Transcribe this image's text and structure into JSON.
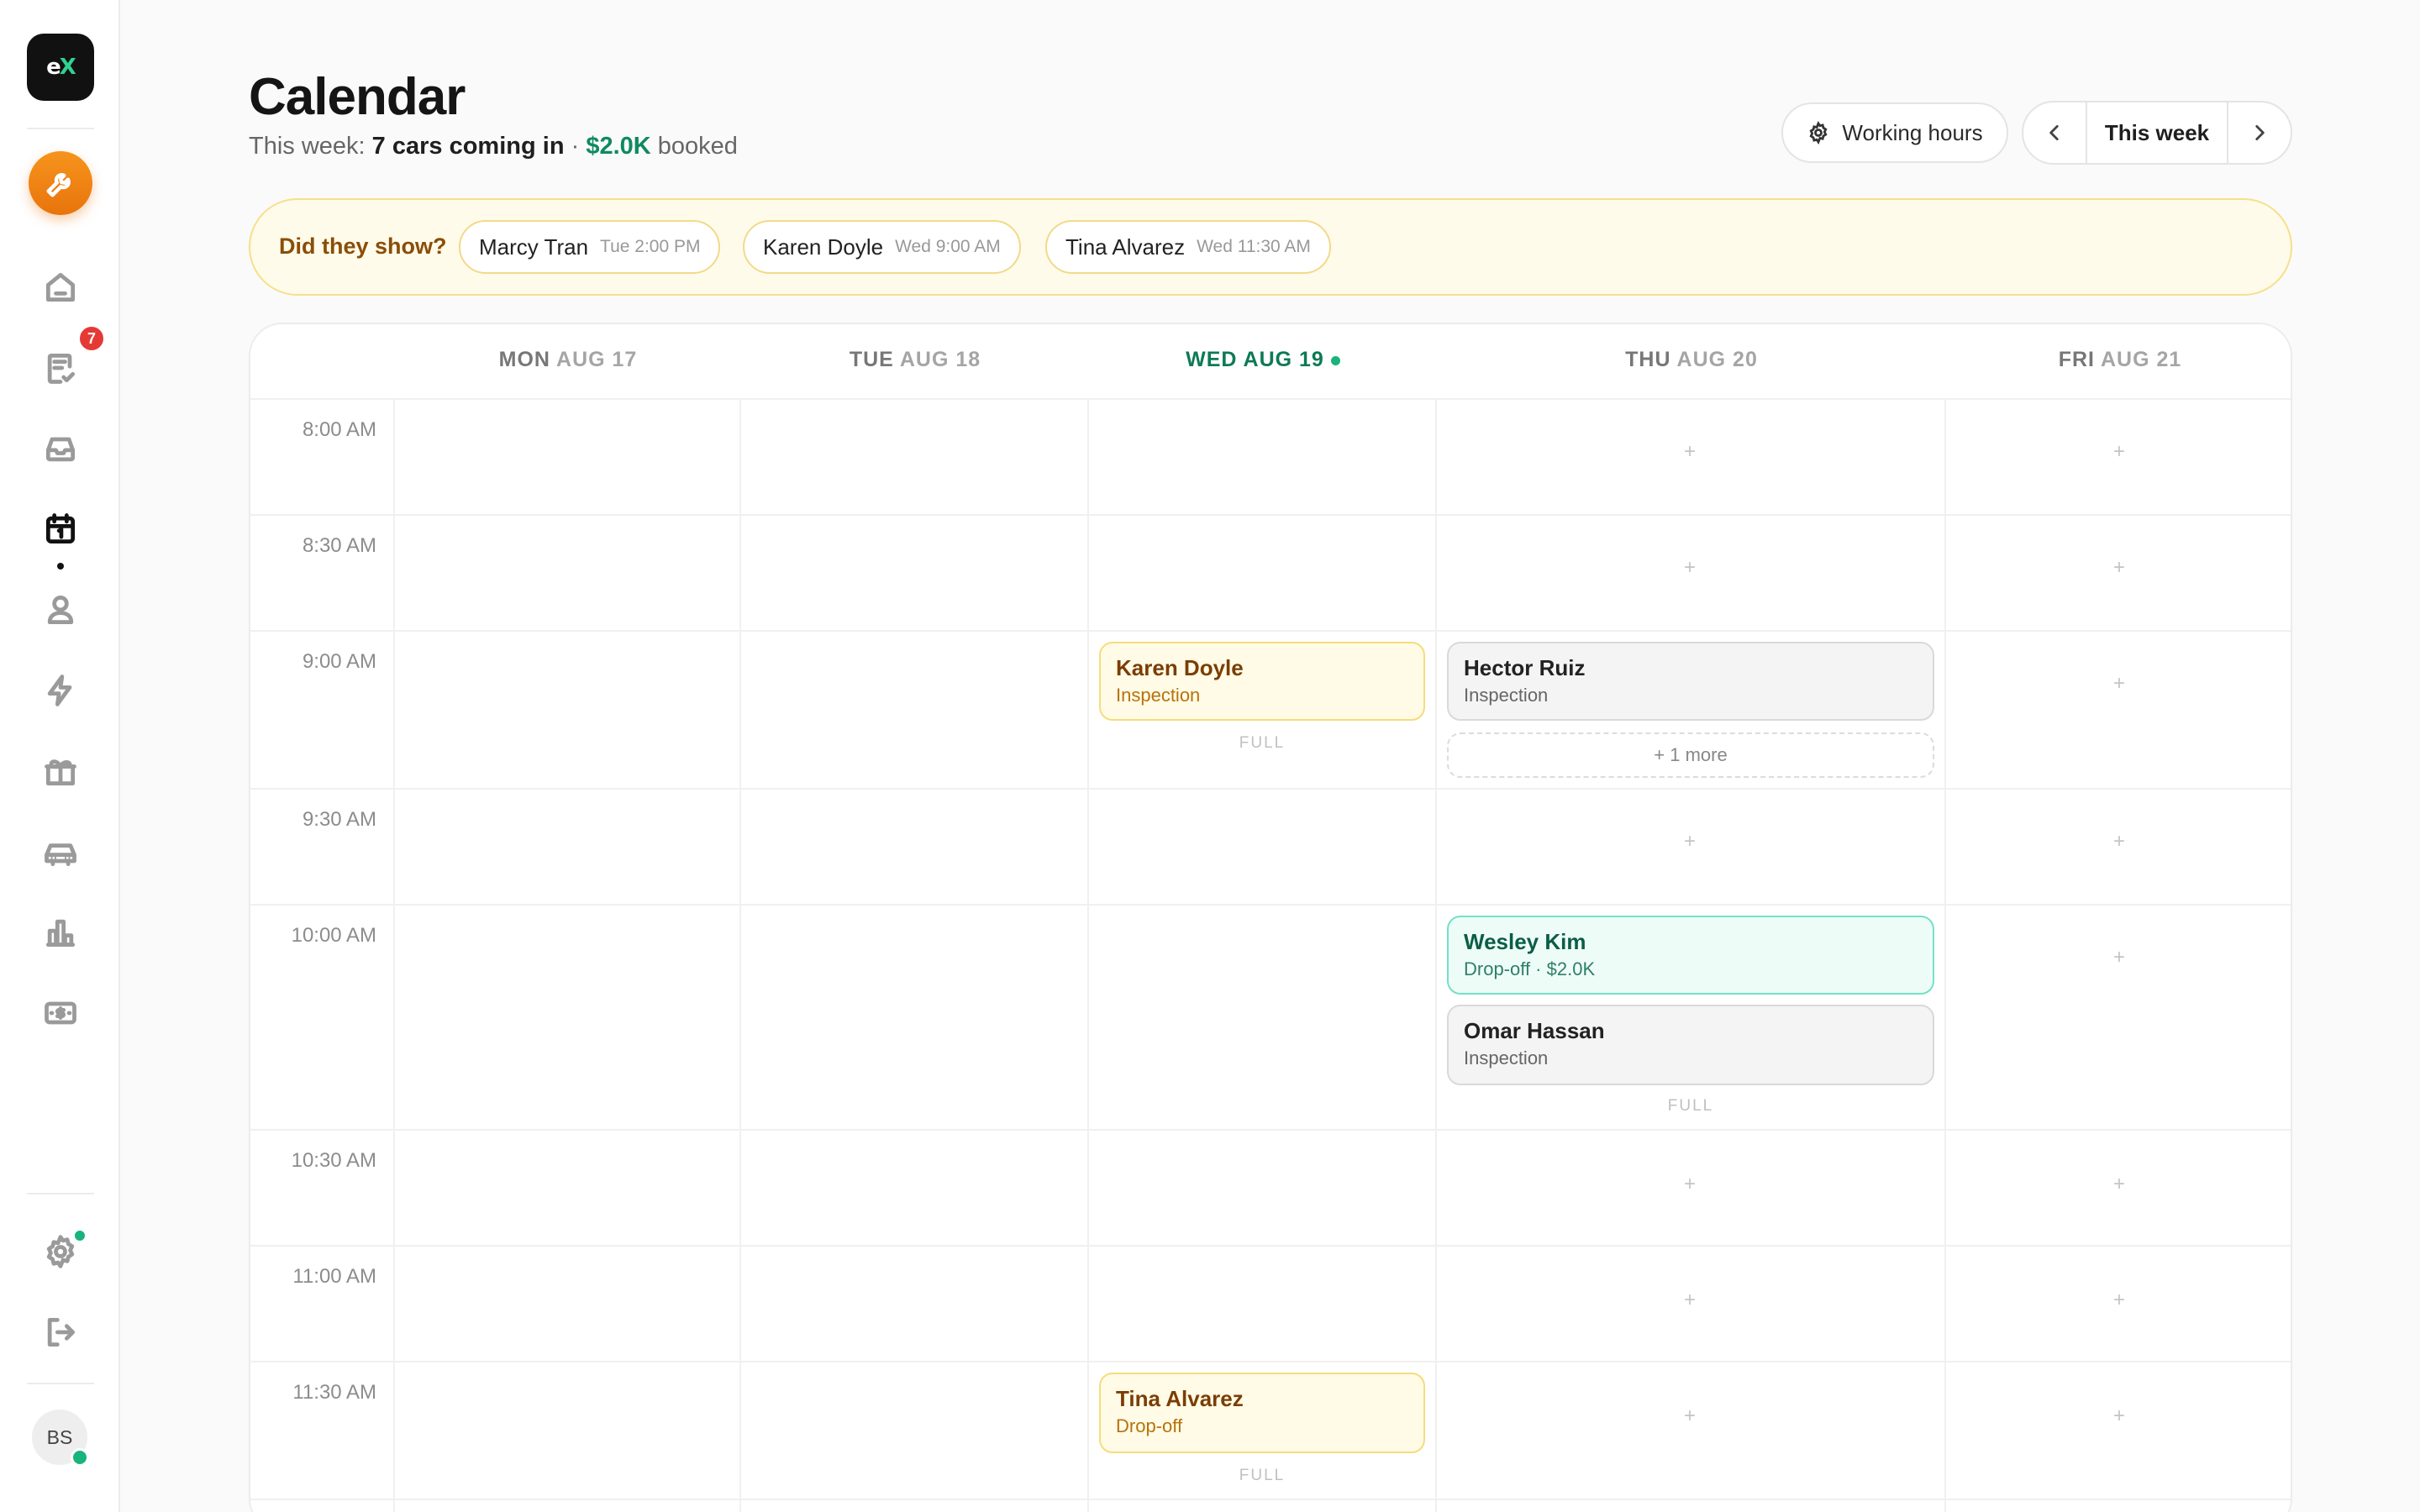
{
  "sidebar": {
    "logo": {
      "e": "e",
      "x": "X"
    },
    "nav_badge_count": "7",
    "avatar_initials": "BS"
  },
  "header": {
    "title": "Calendar",
    "subtitle_prefix": "This week: ",
    "subtitle_cars": "7 cars coming in",
    "subtitle_sep": " · ",
    "subtitle_money": "$2.0K",
    "subtitle_suffix": " booked",
    "working_hours_label": "Working hours",
    "week_label": "This week"
  },
  "banner": {
    "label": "Did they show?",
    "chips": [
      {
        "name": "Marcy Tran",
        "time": "Tue 2:00 PM"
      },
      {
        "name": "Karen Doyle",
        "time": "Wed 9:00 AM"
      },
      {
        "name": "Tina Alvarez",
        "time": "Wed 11:30 AM"
      }
    ]
  },
  "calendar": {
    "days": [
      {
        "name": "MON",
        "date": "AUG 17"
      },
      {
        "name": "TUE",
        "date": "AUG 18"
      },
      {
        "name": "WED",
        "date": "AUG 19"
      },
      {
        "name": "THU",
        "date": "AUG 20"
      },
      {
        "name": "FRI",
        "date": "AUG 21"
      }
    ],
    "times": [
      "8:00 AM",
      "8:30 AM",
      "9:00 AM",
      "9:30 AM",
      "10:00 AM",
      "10:30 AM",
      "11:00 AM",
      "11:30 AM"
    ],
    "plus": "+",
    "full_label": "FULL",
    "events": [
      {
        "name": "Karen Doyle",
        "sub": "Inspection"
      },
      {
        "name": "Hector Ruiz",
        "sub": "Inspection"
      },
      {
        "name": "Wesley Kim",
        "sub": "Drop-off · $2.0K"
      },
      {
        "name": "Omar Hassan",
        "sub": "Inspection"
      },
      {
        "name": "Tina Alvarez",
        "sub": "Drop-off"
      }
    ],
    "more_label": "+ 1 more"
  },
  "colors": {
    "accent_green": "#0e8a5f",
    "tool_orange": "#f7941d",
    "badge_red": "#e53935"
  }
}
